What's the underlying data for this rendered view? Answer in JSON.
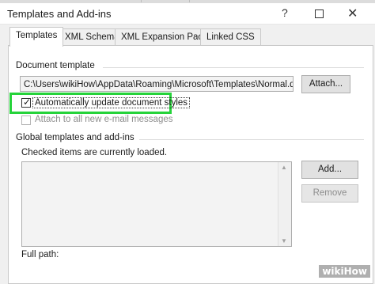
{
  "window": {
    "title": "Templates and Add-ins",
    "help_glyph": "?",
    "close_glyph": "✕"
  },
  "tabs": [
    {
      "label": "Templates",
      "active": true
    },
    {
      "label": "XML Schema",
      "active": false
    },
    {
      "label": "XML Expansion Packs",
      "active": false
    },
    {
      "label": "Linked CSS",
      "active": false
    }
  ],
  "document_template": {
    "group_label": "Document template",
    "path": "C:\\Users\\wikiHow\\AppData\\Roaming\\Microsoft\\Templates\\Normal.dotm",
    "attach_label": "Attach...",
    "auto_update": {
      "label": "Automatically update document styles",
      "checked": true
    },
    "attach_email": {
      "label": "Attach to all new e-mail messages",
      "checked": false,
      "enabled": false
    }
  },
  "global_templates": {
    "group_label": "Global templates and add-ins",
    "note": "Checked items are currently loaded.",
    "add_label": "Add...",
    "remove_label": "Remove",
    "items": []
  },
  "full_path_label": "Full path:",
  "watermark": "wikiHow",
  "colors": {
    "highlight": "#25d33a"
  }
}
